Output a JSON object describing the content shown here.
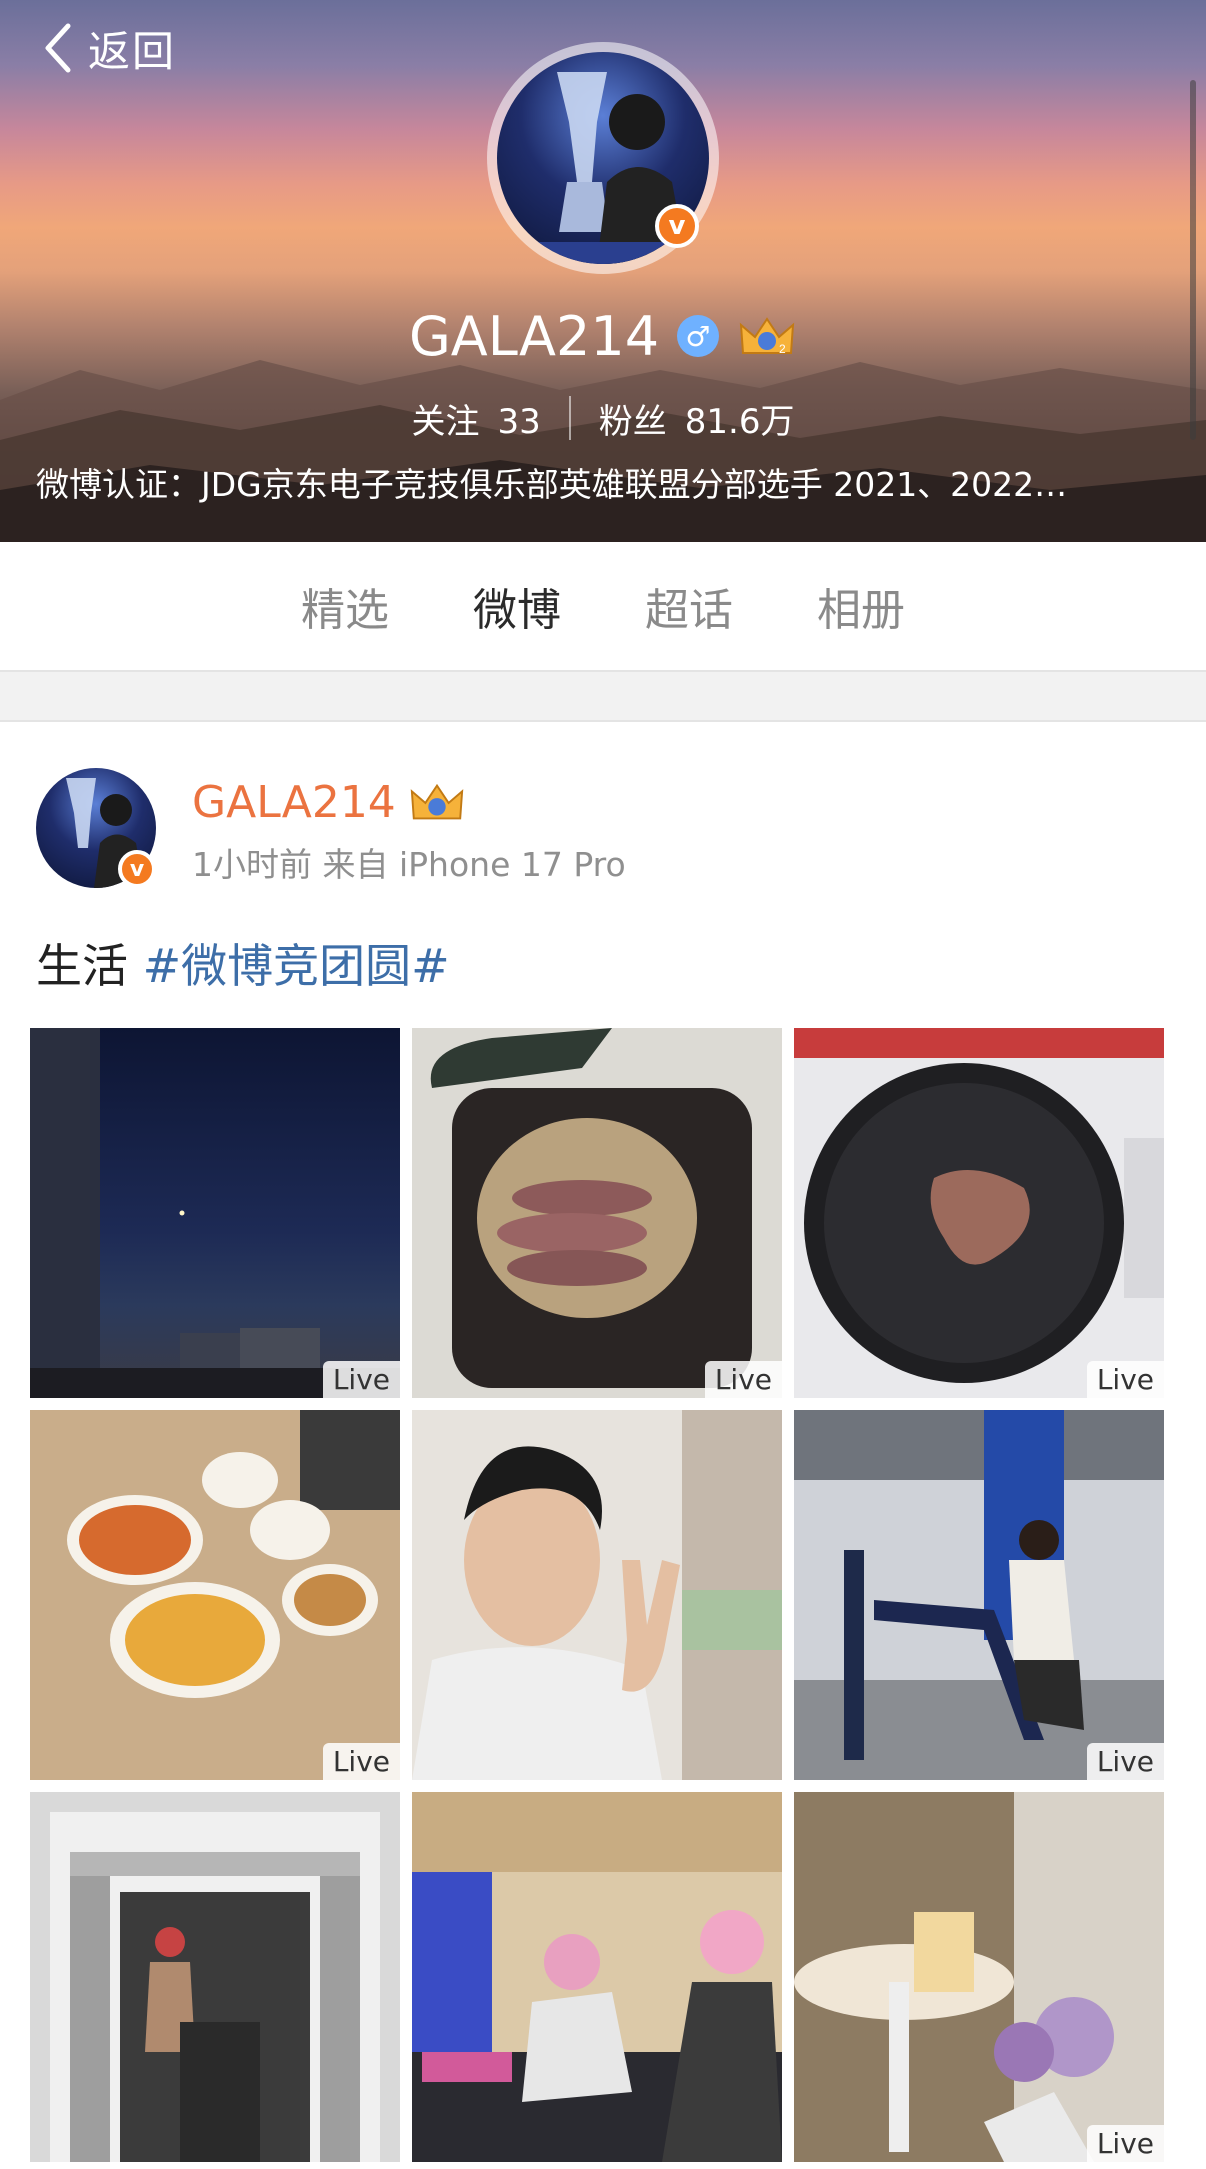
{
  "header": {
    "back_label": "返回",
    "username": "GALA214",
    "gender_symbol": "♂",
    "stats": {
      "following_label": "关注",
      "following_count": "33",
      "followers_label": "粉丝",
      "followers_count": "81.6万"
    },
    "verification": "微博认证：JDG京东电子竞技俱乐部英雄联盟分部选手 2021、2022…"
  },
  "tabs": [
    {
      "label": "精选",
      "active": false
    },
    {
      "label": "微博",
      "active": true
    },
    {
      "label": "超话",
      "active": false
    },
    {
      "label": "相册",
      "active": false
    }
  ],
  "post": {
    "author": "GALA214",
    "meta": "1小时前  来自 iPhone 17 Pro",
    "text": "生活 ",
    "hashtag": "#微博竞团圆#",
    "photos": [
      {
        "desc": "night-sky",
        "live": "Live"
      },
      {
        "desc": "air-fryer-meat",
        "live": "Live"
      },
      {
        "desc": "pan-steak",
        "live": "Live"
      },
      {
        "desc": "noodle-bowls",
        "live": "Live"
      },
      {
        "desc": "selfie-peace",
        "live": ""
      },
      {
        "desc": "gym-machine",
        "live": "Live"
      },
      {
        "desc": "gym-mirror",
        "live": ""
      },
      {
        "desc": "gaming-room",
        "live": ""
      },
      {
        "desc": "room-flowers",
        "live": "Live"
      }
    ]
  },
  "colors": {
    "accent": "#f47a20",
    "author": "#eb7340",
    "hashtag": "#3d6ea8",
    "verified": "#f47a20"
  }
}
